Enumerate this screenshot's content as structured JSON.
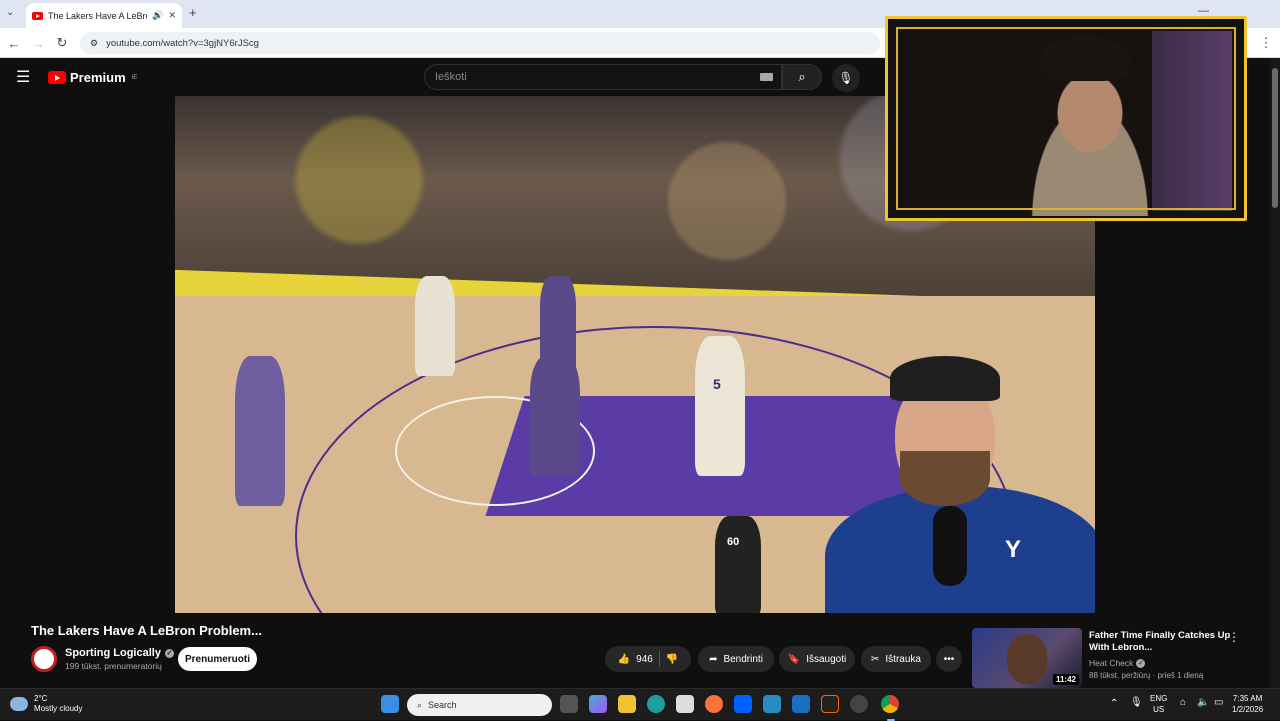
{
  "browser": {
    "tab_title": "The Lakers Have A LeBron Pro",
    "tab_audio_icon": "speaker-icon",
    "new_tab": "+",
    "url": "youtube.com/watch?v=3gjNY6rJScg"
  },
  "youtube": {
    "logo_text": "Premium",
    "logo_country": "IE",
    "search_placeholder": "Ieškoti"
  },
  "video": {
    "title": "The Lakers Have A LeBron Problem...",
    "channel_name": "Sporting Logically",
    "subscribers": "199 tūkst. prenumeratorių",
    "subscribe_label": "Prenumeruoti",
    "like_count": "946",
    "share_label": "Bendrinti",
    "save_label": "Išsaugoti",
    "clip_label": "Ištrauka",
    "overlay_jersey_number": "5",
    "referee_number": "60"
  },
  "recommendation": {
    "title": "Father Time Finally Catches Up With Lebron...",
    "channel": "Heat Check",
    "meta": "88 tūkst. peržiūrų · prieš 1 dieną",
    "duration": "11:42"
  },
  "taskbar": {
    "weather_temp": "2°C",
    "weather_desc": "Mostly cloudy",
    "search_label": "Search",
    "lang_top": "ENG",
    "lang_bottom": "US",
    "time": "7:35 AM",
    "date": "1/2/2026"
  },
  "colors": {
    "youtube_red": "#ff0000",
    "webcam_border": "#f1c232",
    "background": "#0f0f0f"
  }
}
